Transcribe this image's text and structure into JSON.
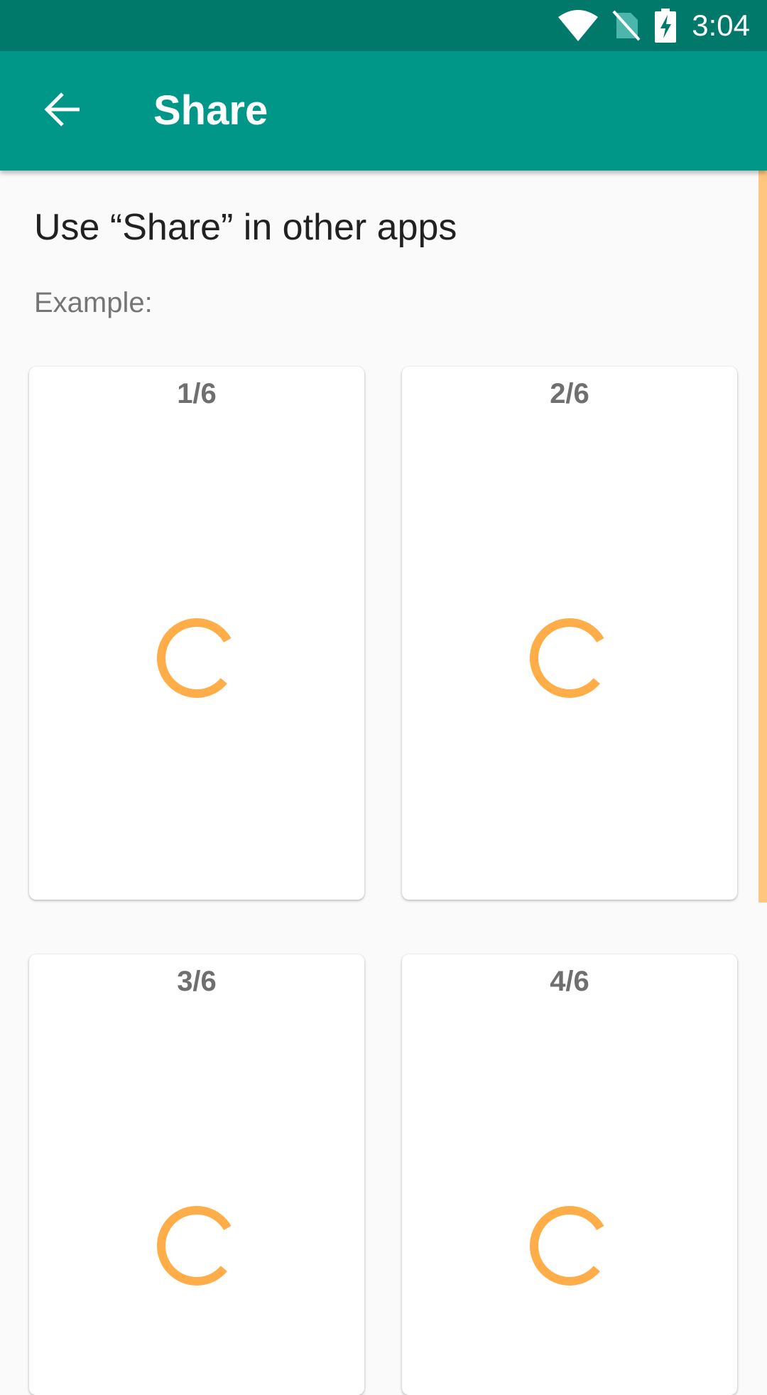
{
  "status_bar": {
    "time": "3:04",
    "icons": [
      "wifi-icon",
      "no-sim-icon",
      "battery-charging-icon"
    ]
  },
  "app_bar": {
    "title": "Share",
    "back_icon": "arrow-back-icon"
  },
  "content": {
    "heading": "Use “Share” in other apps",
    "example_label": "Example:",
    "cards": [
      {
        "label": "1/6"
      },
      {
        "label": "2/6"
      },
      {
        "label": "3/6"
      },
      {
        "label": "4/6"
      }
    ]
  },
  "colors": {
    "status_bar": "#00796b",
    "app_bar": "#009688",
    "accent": "#ffad49",
    "scroll_indicator": "#ffc680",
    "background": "#fafafa"
  }
}
